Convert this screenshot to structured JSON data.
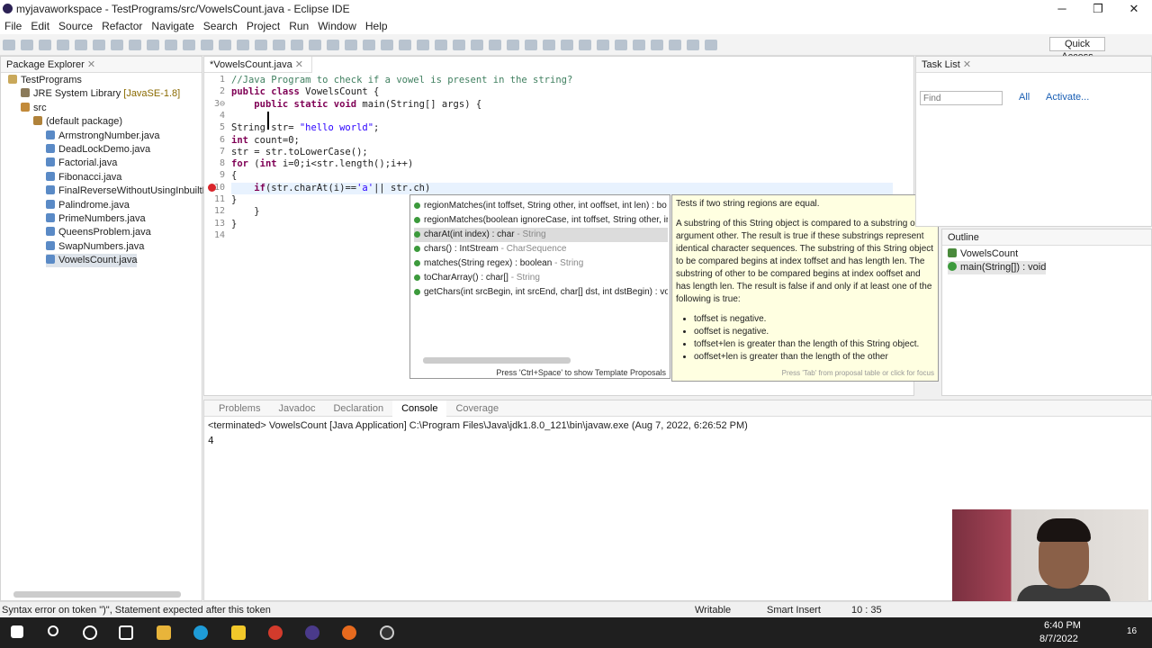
{
  "window": {
    "title": "myjavaworkspace - TestPrograms/src/VowelsCount.java - Eclipse IDE"
  },
  "menu": [
    "File",
    "Edit",
    "Source",
    "Refactor",
    "Navigate",
    "Search",
    "Project",
    "Run",
    "Window",
    "Help"
  ],
  "quick_access": "Quick Access",
  "package_explorer": {
    "tab": "Package Explorer",
    "items": [
      {
        "label": "TestPrograms",
        "indent": 0,
        "icon": "project-icon"
      },
      {
        "label": "JRE System Library",
        "suffix": "[JavaSE-1.8]",
        "indent": 1,
        "icon": "library-icon"
      },
      {
        "label": "src",
        "indent": 1,
        "icon": "folder-icon"
      },
      {
        "label": "(default package)",
        "indent": 2,
        "icon": "package-icon"
      },
      {
        "label": "ArmstrongNumber.java",
        "indent": 3,
        "icon": "java-file-icon"
      },
      {
        "label": "DeadLockDemo.java",
        "indent": 3,
        "icon": "java-file-icon"
      },
      {
        "label": "Factorial.java",
        "indent": 3,
        "icon": "java-file-icon"
      },
      {
        "label": "Fibonacci.java",
        "indent": 3,
        "icon": "java-file-icon"
      },
      {
        "label": "FinalReverseWithoutUsingInbuiltFu",
        "indent": 3,
        "icon": "java-file-icon"
      },
      {
        "label": "Palindrome.java",
        "indent": 3,
        "icon": "java-file-icon"
      },
      {
        "label": "PrimeNumbers.java",
        "indent": 3,
        "icon": "java-file-icon"
      },
      {
        "label": "QueensProblem.java",
        "indent": 3,
        "icon": "java-file-icon"
      },
      {
        "label": "SwapNumbers.java",
        "indent": 3,
        "icon": "java-file-icon"
      },
      {
        "label": "VowelsCount.java",
        "indent": 3,
        "icon": "java-file-icon",
        "selected": true
      }
    ]
  },
  "editor": {
    "tab": "*VowelsCount.java",
    "lines": [
      {
        "n": "1",
        "html": "<span class='cm'>//Java Program to check if a vowel is present in the string?</span>"
      },
      {
        "n": "2",
        "html": "<span class='kw'>public class</span> VowelsCount {"
      },
      {
        "n": "3⊖",
        "html": "    <span class='kw'>public static void</span> main(String[] args) {"
      },
      {
        "n": "4",
        "html": ""
      },
      {
        "n": "5",
        "html": "String str= <span class='st'>\"hello world\"</span>;"
      },
      {
        "n": "6",
        "html": "<span class='kw'>int</span> count=0;"
      },
      {
        "n": "7",
        "html": "str = str.toLowerCase();"
      },
      {
        "n": "8",
        "html": "<span class='kw'>for</span> (<span class='kw'>int</span> i=0;i&lt;str.length();i++)"
      },
      {
        "n": "9",
        "html": "{"
      },
      {
        "n": "10",
        "html": "    <span class='kw'>if</span>(str.charAt(i)==<span class='st'>'a'</span>|| str.ch)"
      },
      {
        "n": "11",
        "html": "}"
      },
      {
        "n": "12",
        "html": "    }"
      },
      {
        "n": "13",
        "html": "}"
      },
      {
        "n": "14",
        "html": ""
      }
    ]
  },
  "proposals": {
    "items": [
      {
        "name": "regionMatches(int toffset, String other, int ooffset, int len) : bo",
        "type": ""
      },
      {
        "name": "regionMatches(boolean ignoreCase, int toffset, String other, in",
        "type": ""
      },
      {
        "name": "charAt(int index) : char",
        "type": " - String",
        "selected": true
      },
      {
        "name": "chars() : IntStream",
        "type": " - CharSequence"
      },
      {
        "name": "matches(String regex) : boolean",
        "type": " - String"
      },
      {
        "name": "toCharArray() : char[]",
        "type": " - String"
      },
      {
        "name": "getChars(int srcBegin, int srcEnd, char[] dst, int dstBegin) : voi",
        "type": ""
      }
    ],
    "footer": "Press 'Ctrl+Space' to show Template Proposals"
  },
  "doc": {
    "title": "Tests if two string regions are equal.",
    "body": "A substring of this String object is compared to a substring of the argument other. The result is true if these substrings represent identical character sequences. The substring of this String object to be compared begins at index toffset and has length len. The substring of other to be compared begins at index ooffset and has length len. The result is false if and only if at least one of the following is true:",
    "bullets": [
      "toffset is negative.",
      "ooffset is negative.",
      "toffset+len is greater than the length of this String object.",
      "ooffset+len is greater than the length of the other"
    ],
    "footer": "Press 'Tab' from proposal table or click for focus"
  },
  "task_list": {
    "tab": "Task List",
    "find_placeholder": "Find",
    "all": "All",
    "activate": "Activate..."
  },
  "outline": {
    "tab": "Outline",
    "class": "VowelsCount",
    "method": "main(String[]) : void"
  },
  "bottom_tabs": [
    "Problems",
    "Javadoc",
    "Declaration",
    "Console",
    "Coverage"
  ],
  "console": {
    "header": "<terminated> VowelsCount [Java Application] C:\\Program Files\\Java\\jdk1.8.0_121\\bin\\javaw.exe (Aug 7, 2022, 6:26:52 PM)",
    "output": "4"
  },
  "status": {
    "message": "Syntax error on token \")\", Statement expected after this token",
    "mode": "Writable",
    "insert": "Smart Insert",
    "pos": "10 : 35"
  },
  "taskbar": {
    "time": "6:40 PM",
    "date": "8/7/2022",
    "notif": "16"
  }
}
